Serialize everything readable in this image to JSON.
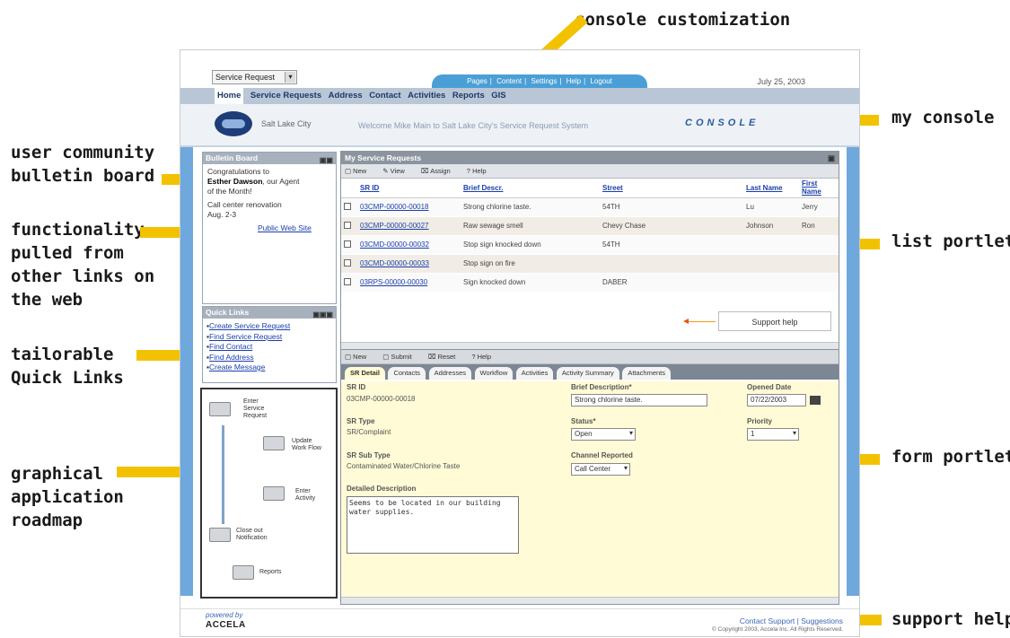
{
  "callouts": {
    "console_customization": "console customization",
    "my_console": "my console",
    "bulletin_1": "user community",
    "bulletin_2": "bulletin board",
    "func_1": "functionality",
    "func_2": "pulled from",
    "func_3": "other links on",
    "func_4": "the web",
    "ql_1": "tailorable",
    "ql_2": "Quick Links",
    "list_portlet": "list portlet",
    "graph_1": "graphical",
    "graph_2": "application",
    "graph_3": "roadmap",
    "form_portlet": "form portlet",
    "support_help": "support help"
  },
  "header": {
    "service_select": "Service Request",
    "top_tabs": [
      "Pages",
      "Content",
      "Settings",
      "Help",
      "Logout"
    ],
    "date": "July 25, 2003",
    "menu": [
      "Home",
      "Service Requests",
      "Address",
      "Contact",
      "Activities",
      "Reports",
      "GIS"
    ],
    "city": "Salt Lake City",
    "welcome": "Welcome Mike Main to Salt Lake City's Service Request System",
    "console_label": "CONSOLE"
  },
  "bulletin": {
    "title": "Bulletin Board",
    "line1": "Congratulations to",
    "line2_bold": "Esther Dawson",
    "line2_rest": ", our Agent",
    "line3": "of the Month!",
    "line4": "Call center renovation",
    "line5": "Aug. 2-3",
    "link": "Public Web Site"
  },
  "quick_links": {
    "title": "Quick Links",
    "items": [
      "Create Service Request",
      "Find Service Request",
      "Find Contact",
      "Find Address",
      "Create Message"
    ]
  },
  "roadmap": {
    "steps": [
      "Enter Service Request",
      "Update Work Flow",
      "Enter Activity",
      "Close out Notification",
      "Reports"
    ]
  },
  "list": {
    "title": "My Service Requests",
    "toolbar": [
      "New",
      "View",
      "Assign",
      "Help"
    ],
    "columns": [
      "SR ID",
      "Brief Descr.",
      "Street",
      "Last Name",
      "First Name"
    ],
    "rows": [
      [
        "03CMP-00000-00018",
        "Strong chlorine taste.",
        "54TH",
        "Lu",
        "Jerry"
      ],
      [
        "03CMP-00000-00027",
        "Raw sewage smell",
        "Chevy Chase",
        "Johnson",
        "Ron"
      ],
      [
        "03CMD-00000-00032",
        "Stop sign knocked down",
        "54TH",
        "",
        ""
      ],
      [
        "03CMD-00000-00033",
        "Stop sign on fire",
        "",
        "",
        ""
      ],
      [
        "03RPS-00000-00030",
        "Sign knocked down",
        "DABER",
        "",
        ""
      ]
    ],
    "support_help": "Support help"
  },
  "form": {
    "toolbar": [
      "New",
      "Submit",
      "Reset",
      "Help"
    ],
    "tabs": [
      "SR Detail",
      "Contacts",
      "Addresses",
      "Workflow",
      "Activities",
      "Activity Summary",
      "Attachments"
    ],
    "sr_id_label": "SR ID",
    "sr_id_value": "03CMP-00000-00018",
    "brief_label": "Brief Description*",
    "brief_value": "Strong chlorine taste.",
    "opened_label": "Opened Date",
    "opened_value": "07/22/2003",
    "sr_type_label": "SR Type",
    "sr_type_value": "SR/Complaint",
    "status_label": "Status*",
    "status_value": "Open",
    "priority_label": "Priority",
    "priority_value": "1",
    "subtype_label": "SR Sub Type",
    "subtype_value": "Contaminated Water/Chlorine Taste",
    "channel_label": "Channel Reported",
    "channel_value": "Call Center",
    "detail_label": "Detailed Description",
    "detail_value": "Seems to be located in our building water supplies."
  },
  "footer": {
    "powered": "powered by",
    "brand": "ACCELA",
    "contact": "Contact Support | Suggestions",
    "copyright": "© Copyright 2003, Accela Inc. All Rights Reserved."
  }
}
